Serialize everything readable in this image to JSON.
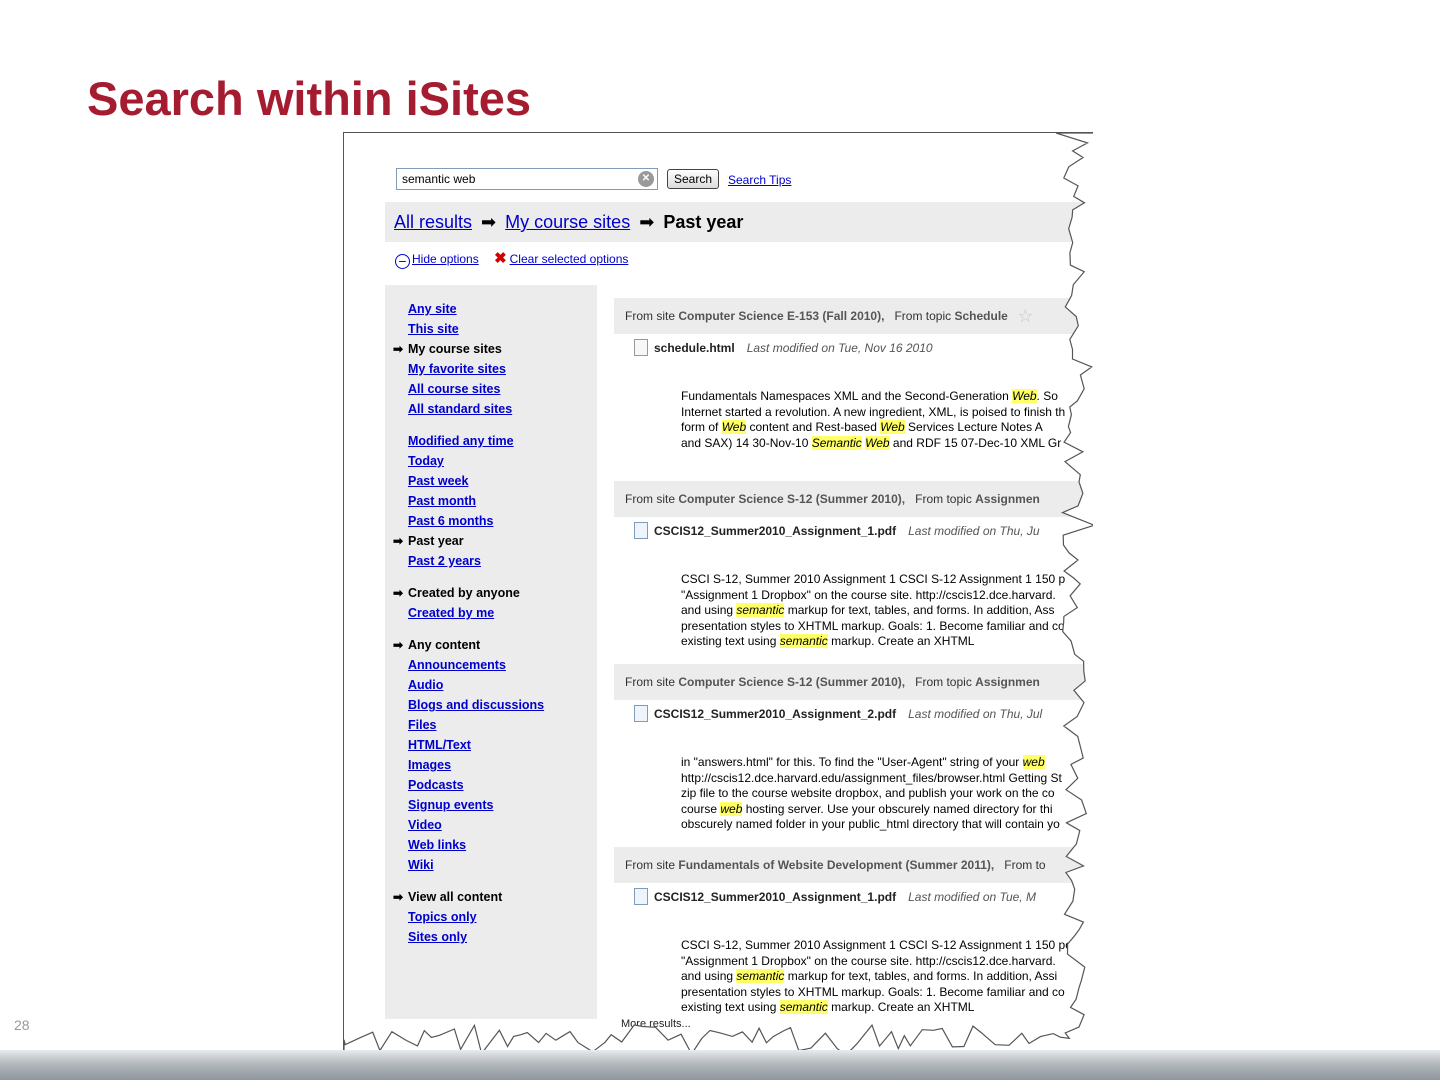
{
  "slide": {
    "title": "Search within iSites",
    "number": "28"
  },
  "search": {
    "value": "semantic web",
    "button_label": "Search",
    "tips_label": "Search Tips"
  },
  "breadcrumb": {
    "all": "All results",
    "course": "My course sites",
    "current": "Past year",
    "arrow": "➡"
  },
  "options": {
    "hide": "Hide options",
    "clear": "Clear selected options"
  },
  "sidebar": {
    "groups": [
      [
        {
          "label": "Any site",
          "link": true
        },
        {
          "label": "This site",
          "link": true
        },
        {
          "label": "My course sites",
          "link": false
        },
        {
          "label": "My favorite sites",
          "link": true
        },
        {
          "label": "All course sites",
          "link": true
        },
        {
          "label": "All standard sites",
          "link": true
        }
      ],
      [
        {
          "label": "Modified any time",
          "link": true
        },
        {
          "label": "Today",
          "link": true
        },
        {
          "label": "Past week",
          "link": true
        },
        {
          "label": "Past month",
          "link": true
        },
        {
          "label": "Past 6 months",
          "link": true
        },
        {
          "label": "Past year",
          "link": false
        },
        {
          "label": "Past 2 years",
          "link": true
        }
      ],
      [
        {
          "label": "Created by anyone",
          "link": false
        },
        {
          "label": "Created by me",
          "link": true
        }
      ],
      [
        {
          "label": "Any content",
          "link": false
        },
        {
          "label": "Announcements",
          "link": true
        },
        {
          "label": "Audio",
          "link": true
        },
        {
          "label": "Blogs and discussions",
          "link": true
        },
        {
          "label": "Files",
          "link": true
        },
        {
          "label": "HTML/Text",
          "link": true
        },
        {
          "label": "Images",
          "link": true
        },
        {
          "label": "Podcasts",
          "link": true
        },
        {
          "label": "Signup events",
          "link": true
        },
        {
          "label": "Video",
          "link": true
        },
        {
          "label": "Web links",
          "link": true
        },
        {
          "label": "Wiki",
          "link": true
        }
      ],
      [
        {
          "label": "View all content",
          "link": false
        },
        {
          "label": "Topics only",
          "link": true
        },
        {
          "label": "Sites only",
          "link": true
        }
      ]
    ]
  },
  "results": [
    {
      "site_prefix": "From site",
      "site": "Computer Science E-153 (Fall 2010),",
      "topic_prefix": "From topic",
      "topic": "Schedule",
      "star": true,
      "file": "schedule.html",
      "file_type": "html",
      "modified": "Last modified on Tue, Nov 16 2010",
      "snippet": [
        [
          {
            "t": "Fundamentals Namespaces XML and the Second-Generation "
          },
          {
            "t": "Web",
            "h": true
          },
          {
            "t": ". So"
          }
        ],
        [
          {
            "t": "Internet started a revolution. A new ingredient, XML, is poised to finish th"
          }
        ],
        [
          {
            "t": "form of "
          },
          {
            "t": "Web",
            "h": true
          },
          {
            "t": " content and Rest-based "
          },
          {
            "t": "Web",
            "h": true
          },
          {
            "t": " Services Lecture Notes A"
          }
        ],
        [
          {
            "t": "and SAX) 14 30-Nov-10 "
          },
          {
            "t": "Semantic",
            "h": true
          },
          {
            "t": " "
          },
          {
            "t": "Web",
            "h": true
          },
          {
            "t": " and RDF 15 07-Dec-10 XML Gr"
          }
        ]
      ]
    },
    {
      "site_prefix": "From site",
      "site": "Computer Science S-12 (Summer 2010),",
      "topic_prefix": "From topic",
      "topic": "Assignmen",
      "star": false,
      "file": "CSCIS12_Summer2010_Assignment_1.pdf",
      "file_type": "pdf",
      "modified": "Last modified on Thu, Ju",
      "snippet": [
        [
          {
            "t": "CSCI S-12, Summer 2010 Assignment 1 CSCI S-12 Assignment 1 150 p"
          }
        ],
        [
          {
            "t": "\"Assignment 1 Dropbox\" on the course site. http://cscis12.dce.harvard."
          }
        ],
        [
          {
            "t": "and using "
          },
          {
            "t": "semantic",
            "h": true
          },
          {
            "t": " markup for text, tables, and forms. In addition, Ass"
          }
        ],
        [
          {
            "t": "presentation styles to XHTML markup. Goals: 1. Become familiar and co"
          }
        ],
        [
          {
            "t": "existing text using "
          },
          {
            "t": "semantic",
            "h": true
          },
          {
            "t": " markup. Create an XHTML"
          }
        ]
      ]
    },
    {
      "site_prefix": "From site",
      "site": "Computer Science S-12 (Summer 2010),",
      "topic_prefix": "From topic",
      "topic": "Assignmen",
      "star": false,
      "file": "CSCIS12_Summer2010_Assignment_2.pdf",
      "file_type": "pdf",
      "modified": "Last modified on Thu, Jul",
      "snippet": [
        [
          {
            "t": "in \"answers.html\" for this. To find the \"User-Agent\" string of your "
          },
          {
            "t": "web",
            "h": true
          }
        ],
        [
          {
            "t": "http://cscis12.dce.harvard.edu/assignment_files/browser.html Getting St"
          }
        ],
        [
          {
            "t": "zip file to the course website dropbox, and publish your work on the co"
          }
        ],
        [
          {
            "t": "course "
          },
          {
            "t": "web",
            "h": true
          },
          {
            "t": " hosting server. Use your obscurely named directory for thi"
          }
        ],
        [
          {
            "t": "obscurely named folder in your public_html directory that will contain yo"
          }
        ]
      ]
    },
    {
      "site_prefix": "From site",
      "site": "Fundamentals of Website Development (Summer 2011),",
      "topic_prefix": "From to",
      "topic": "",
      "star": false,
      "file": "CSCIS12_Summer2010_Assignment_1.pdf",
      "file_type": "pdf",
      "modified": "Last modified on Tue, M",
      "snippet": [
        [
          {
            "t": "CSCI S-12, Summer 2010 Assignment 1 CSCI S-12 Assignment 1 150 po"
          }
        ],
        [
          {
            "t": "\"Assignment 1 Dropbox\" on the course site. http://cscis12.dce.harvard."
          }
        ],
        [
          {
            "t": "and using "
          },
          {
            "t": "semantic",
            "h": true
          },
          {
            "t": " markup for text, tables, and forms. In addition, Assi"
          }
        ],
        [
          {
            "t": "presentation styles to XHTML markup. Goals: 1. Become familiar and co"
          }
        ],
        [
          {
            "t": "existing text using "
          },
          {
            "t": "semantic",
            "h": true
          },
          {
            "t": " markup. Create an XHTML"
          }
        ]
      ]
    }
  ],
  "more_results": "More results...",
  "colors": {
    "title": "#a51c30",
    "link": "#0000cc",
    "highlight": "#ffff66",
    "panel": "#ececec"
  }
}
